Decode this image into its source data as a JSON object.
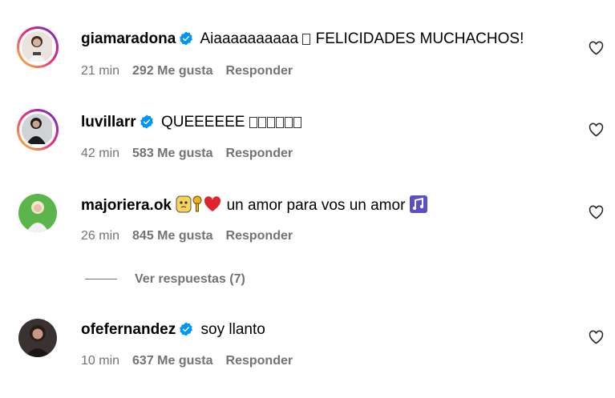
{
  "comments": [
    {
      "username": "giamaradona",
      "verified": true,
      "text_before": "Aiaaaaaaaaaa",
      "text_after": "FELICIDADES MUCHACHOS!",
      "time": "21 min",
      "likes": "292 Me gusta",
      "reply": "Responder"
    },
    {
      "username": "luvillarr",
      "verified": true,
      "text": "QUEEEEEE",
      "time": "42 min",
      "likes": "583 Me gusta",
      "reply": "Responder"
    },
    {
      "username": "majoriera.ok",
      "verified": false,
      "text": "un amor para vos un amor",
      "time": "26 min",
      "likes": "845 Me gusta",
      "reply": "Responder"
    },
    {
      "username": "ofefernandez",
      "verified": true,
      "text": "soy llanto",
      "time": "10 min",
      "likes": "637 Me gusta",
      "reply": "Responder"
    }
  ],
  "view_replies": "Ver respuestas (7)",
  "icons": {
    "verified": "verified-badge-icon",
    "like": "heart-outline-icon"
  },
  "colors": {
    "verified_blue": "#0095f6",
    "secondary_text": "#737373"
  }
}
